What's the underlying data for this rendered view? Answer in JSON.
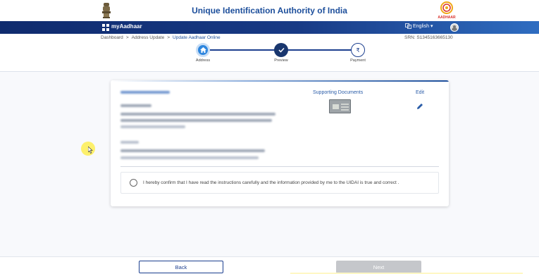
{
  "header": {
    "title": "Unique Identification Authority of India",
    "logo_text": "AADHAAR"
  },
  "navbar": {
    "app_name": "myAadhaar",
    "language": "English",
    "language_caret": "▾"
  },
  "breadcrumb": {
    "items": [
      "Dashboard",
      "Address Update",
      "Update Aadhaar Online"
    ],
    "separator": ">"
  },
  "srn": "SRN: S1345163665130",
  "stepper": {
    "steps": [
      {
        "label": "Address",
        "state": "active",
        "icon": "home-icon"
      },
      {
        "label": "Preview",
        "state": "completed",
        "icon": "check-icon"
      },
      {
        "label": "Payment",
        "state": "pending",
        "icon": "rupee-icon",
        "glyph": "₹"
      }
    ]
  },
  "card": {
    "supporting_documents_label": "Supporting Documents",
    "edit_label": "Edit",
    "confirm_text": "I hereby confirm that I have read the instructions carefully and the information provided by me to the UIDAI is true and correct ."
  },
  "footer": {
    "back_label": "Back",
    "next_label": "Next"
  },
  "colors": {
    "primary": "#1c4e9b",
    "navbar": "#0f2b6e",
    "disabled_button": "#c5c7cb"
  }
}
